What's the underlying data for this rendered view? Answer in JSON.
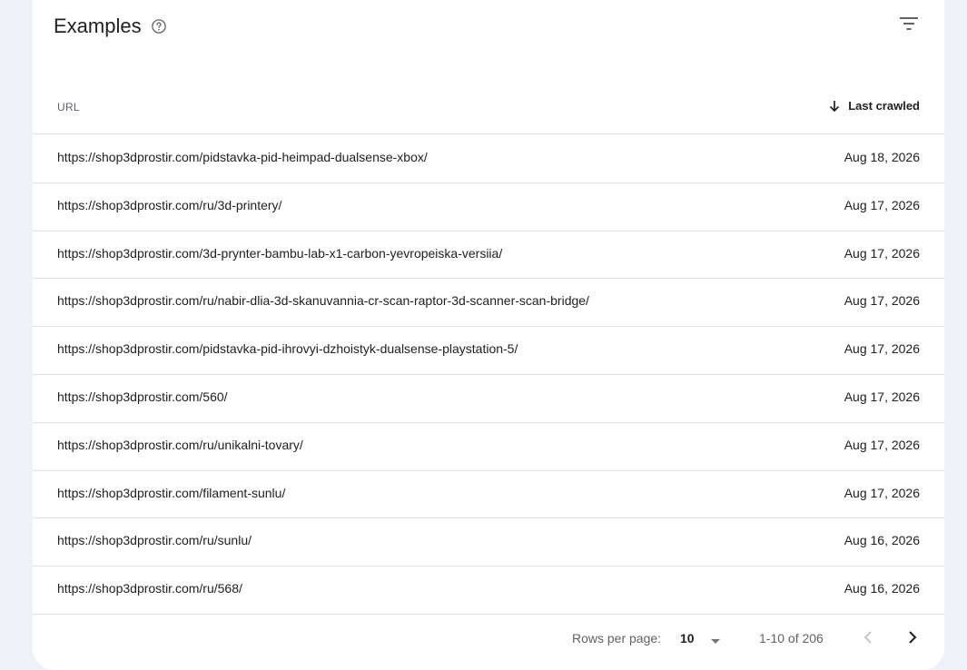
{
  "header": {
    "title": "Examples"
  },
  "table": {
    "columns": {
      "url": "URL",
      "date": "Last crawled"
    },
    "rows": [
      {
        "url": "https://shop3dprostir.com/pidstavka-pid-heimpad-dualsense-xbox/",
        "date": "Aug 18, 2026"
      },
      {
        "url": "https://shop3dprostir.com/ru/3d-printery/",
        "date": "Aug 17, 2026"
      },
      {
        "url": "https://shop3dprostir.com/3d-prynter-bambu-lab-x1-carbon-yevropeiska-versiia/",
        "date": "Aug 17, 2026"
      },
      {
        "url": "https://shop3dprostir.com/ru/nabir-dlia-3d-skanuvannia-cr-scan-raptor-3d-scanner-scan-bridge/",
        "date": "Aug 17, 2026"
      },
      {
        "url": "https://shop3dprostir.com/pidstavka-pid-ihrovyi-dzhoistyk-dualsense-playstation-5/",
        "date": "Aug 17, 2026"
      },
      {
        "url": "https://shop3dprostir.com/560/",
        "date": "Aug 17, 2026"
      },
      {
        "url": "https://shop3dprostir.com/ru/unikalni-tovary/",
        "date": "Aug 17, 2026"
      },
      {
        "url": "https://shop3dprostir.com/filament-sunlu/",
        "date": "Aug 17, 2026"
      },
      {
        "url": "https://shop3dprostir.com/ru/sunlu/",
        "date": "Aug 16, 2026"
      },
      {
        "url": "https://shop3dprostir.com/ru/568/",
        "date": "Aug 16, 2026"
      }
    ]
  },
  "pagination": {
    "rows_per_page_label": "Rows per page:",
    "rows_per_page_value": "10",
    "range": "1-10 of 206"
  },
  "icons": {
    "help": "help-circle-icon",
    "filter": "filter-list-icon",
    "sort": "arrow-down-icon",
    "dropdown": "caret-down-icon",
    "prev": "chevron-left-icon",
    "next": "chevron-right-icon"
  }
}
